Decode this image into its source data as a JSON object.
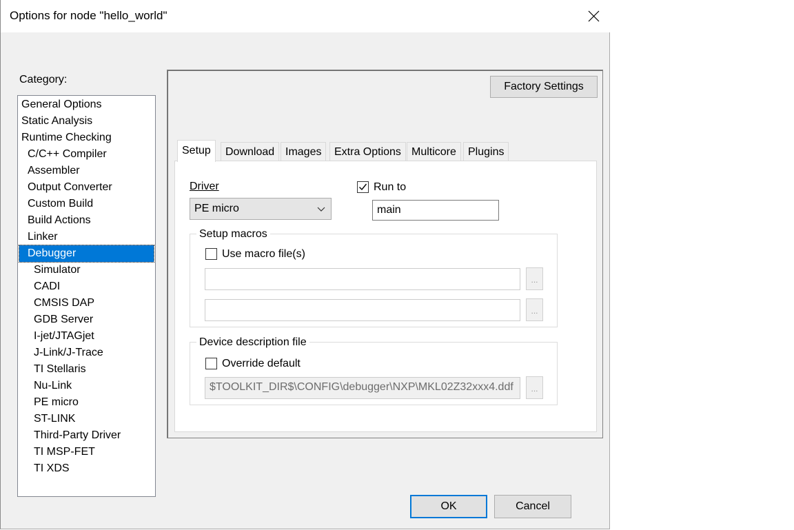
{
  "window": {
    "title": "Options for node \"hello_world\""
  },
  "category": {
    "label": "Category:",
    "items": [
      {
        "label": "General Options",
        "level": 0,
        "selected": false
      },
      {
        "label": "Static Analysis",
        "level": 0,
        "selected": false
      },
      {
        "label": "Runtime Checking",
        "level": 0,
        "selected": false
      },
      {
        "label": "C/C++ Compiler",
        "level": 1,
        "selected": false
      },
      {
        "label": "Assembler",
        "level": 1,
        "selected": false
      },
      {
        "label": "Output Converter",
        "level": 1,
        "selected": false
      },
      {
        "label": "Custom Build",
        "level": 1,
        "selected": false
      },
      {
        "label": "Build Actions",
        "level": 1,
        "selected": false
      },
      {
        "label": "Linker",
        "level": 1,
        "selected": false
      },
      {
        "label": "Debugger",
        "level": 1,
        "selected": true
      },
      {
        "label": "Simulator",
        "level": 2,
        "selected": false
      },
      {
        "label": "CADI",
        "level": 2,
        "selected": false
      },
      {
        "label": "CMSIS DAP",
        "level": 2,
        "selected": false
      },
      {
        "label": "GDB Server",
        "level": 2,
        "selected": false
      },
      {
        "label": "I-jet/JTAGjet",
        "level": 2,
        "selected": false
      },
      {
        "label": "J-Link/J-Trace",
        "level": 2,
        "selected": false
      },
      {
        "label": "TI Stellaris",
        "level": 2,
        "selected": false
      },
      {
        "label": "Nu-Link",
        "level": 2,
        "selected": false
      },
      {
        "label": "PE micro",
        "level": 2,
        "selected": false
      },
      {
        "label": "ST-LINK",
        "level": 2,
        "selected": false
      },
      {
        "label": "Third-Party Driver",
        "level": 2,
        "selected": false
      },
      {
        "label": "TI MSP-FET",
        "level": 2,
        "selected": false
      },
      {
        "label": "TI XDS",
        "level": 2,
        "selected": false
      }
    ]
  },
  "factory_settings_label": "Factory Settings",
  "tabs": [
    {
      "label": "Setup",
      "active": true
    },
    {
      "label": "Download",
      "active": false
    },
    {
      "label": "Images",
      "active": false
    },
    {
      "label": "Extra Options",
      "active": false
    },
    {
      "label": "Multicore",
      "active": false
    },
    {
      "label": "Plugins",
      "active": false
    }
  ],
  "setup": {
    "driver_label": "Driver",
    "driver_value": "PE micro",
    "run_to_label": "Run to",
    "run_to_checked": true,
    "run_to_value": "main",
    "setup_macros_title": "Setup macros",
    "use_macro_label": "Use macro file(s)",
    "use_macro_checked": false,
    "macro_file_1": "",
    "macro_file_2": "",
    "browse_label": "...",
    "device_desc_title": "Device description file",
    "override_label": "Override default",
    "override_checked": false,
    "device_desc_path": "$TOOLKIT_DIR$\\CONFIG\\debugger\\NXP\\MKL02Z32xxx4.ddf"
  },
  "buttons": {
    "ok": "OK",
    "cancel": "Cancel"
  },
  "colors": {
    "selection": "#0078d7",
    "dialog_bg": "#f0f0f0"
  }
}
